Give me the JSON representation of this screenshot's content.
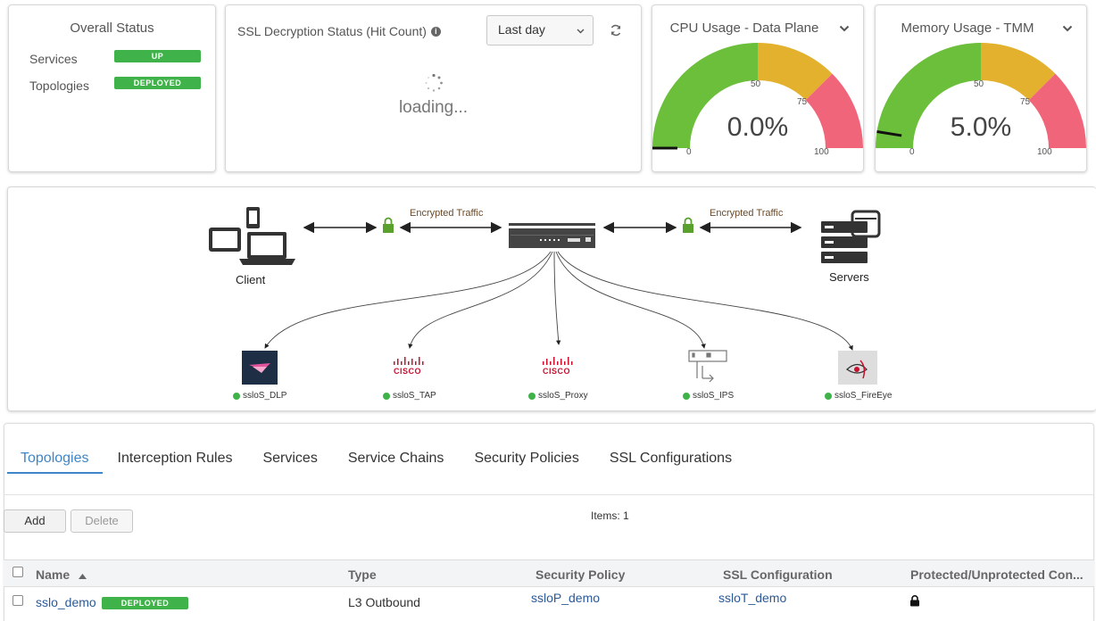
{
  "overall": {
    "title": "Overall Status",
    "rows": [
      {
        "label": "Services",
        "badge": "UP"
      },
      {
        "label": "Topologies",
        "badge": "DEPLOYED"
      }
    ]
  },
  "ssl": {
    "title": "SSL Decryption Status (Hit Count)",
    "range": "Last day",
    "loading": "loading..."
  },
  "cpu": {
    "title": "CPU Usage - Data Plane",
    "value": "0.0%",
    "percent": 0,
    "ticks": {
      "t0": "0",
      "t50": "50",
      "t75": "75",
      "t100": "100"
    }
  },
  "memory": {
    "title": "Memory Usage - TMM",
    "value": "5.0%",
    "percent": 5,
    "ticks": {
      "t0": "0",
      "t50": "50",
      "t75": "75",
      "t100": "100"
    }
  },
  "gauge_colors": {
    "green": "#6cbf3a",
    "yellow": "#e3b12d",
    "red": "#f0657a"
  },
  "diagram": {
    "client": "Client",
    "servers": "Servers",
    "encrypted_left": "Encrypted Traffic",
    "encrypted_right": "Encrypted Traffic",
    "services": [
      {
        "name": "ssloS_DLP",
        "icon": "dlp-icon"
      },
      {
        "name": "ssloS_TAP",
        "icon": "cisco-icon",
        "logo": "CISCO"
      },
      {
        "name": "ssloS_Proxy",
        "icon": "cisco-icon",
        "logo": "CISCO"
      },
      {
        "name": "ssloS_IPS",
        "icon": "ips-icon"
      },
      {
        "name": "ssloS_FireEye",
        "icon": "fireeye-icon"
      }
    ]
  },
  "tabs": [
    "Topologies",
    "Interception Rules",
    "Services",
    "Service Chains",
    "Security Policies",
    "SSL Configurations"
  ],
  "toolbar": {
    "add": "Add",
    "delete": "Delete",
    "items": "Items: 1"
  },
  "table": {
    "columns": [
      "Name",
      "Type",
      "Security Policy",
      "SSL Configuration",
      "Protected/Unprotected Con..."
    ],
    "rows": [
      {
        "name": "sslo_demo",
        "status": "DEPLOYED",
        "type": "L3 Outbound",
        "policy": "ssloP_demo",
        "ssl": "ssloT_demo",
        "protected_icon": "lock-icon"
      }
    ]
  }
}
